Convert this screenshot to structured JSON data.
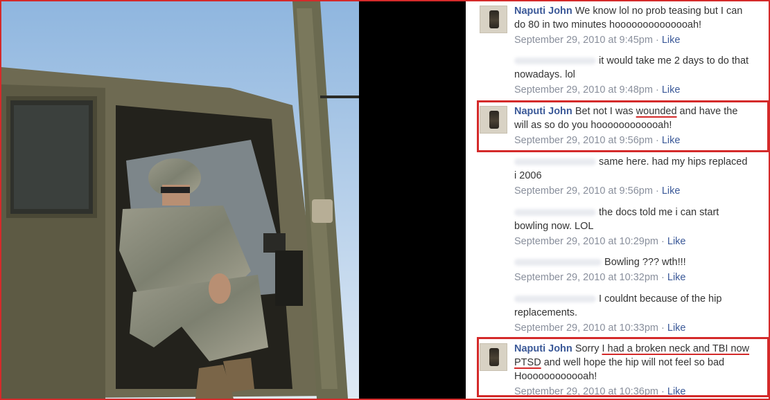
{
  "comments": [
    {
      "author": "Naputi John",
      "text_parts": [
        "We know lol no prob teasing but I can do 80 in two minutes hoooooooooooooah!"
      ],
      "timestamp": "September 29, 2010 at 9:45pm",
      "like": "Like"
    },
    {
      "author": "",
      "text_parts": [
        "it would take me 2 days to do that nowadays. lol"
      ],
      "timestamp": "September 29, 2010 at 9:48pm",
      "like": "Like"
    },
    {
      "author": "Naputi John",
      "text_parts": [
        "Bet not I was ",
        "wounded",
        " and have the will as so do you hoooooooooooah!"
      ],
      "timestamp": "September 29, 2010 at 9:56pm",
      "like": "Like"
    },
    {
      "author": "",
      "text_parts": [
        "same here. had my hips replaced",
        "i 2006"
      ],
      "timestamp": "September 29, 2010 at 9:56pm",
      "like": "Like"
    },
    {
      "author": "",
      "text_parts": [
        "the docs told me i can start bowling now. LOL"
      ],
      "timestamp": "September 29, 2010 at 10:29pm",
      "like": "Like"
    },
    {
      "author": "",
      "text_parts": [
        "Bowling ??? wth!!!"
      ],
      "timestamp": "September 29, 2010 at 10:32pm",
      "like": "Like"
    },
    {
      "author": "",
      "text_parts": [
        "I couldnt because of the hip replacements."
      ],
      "timestamp": "September 29, 2010 at 10:33pm",
      "like": "Like"
    },
    {
      "author": "Naputi John",
      "text_parts": [
        "Sorry ",
        "I had a broken neck and TBI now",
        " ",
        "PTSD",
        " and well hope the hip will not feel so bad Hoooooooooooah!"
      ],
      "timestamp": "September 29, 2010 at 10:36pm",
      "like": "Like"
    }
  ],
  "meta_separator": " · ",
  "colors": {
    "frame_red": "#d42a2a",
    "facebook_blue": "#3b5998",
    "meta_grey": "#898f9c"
  }
}
